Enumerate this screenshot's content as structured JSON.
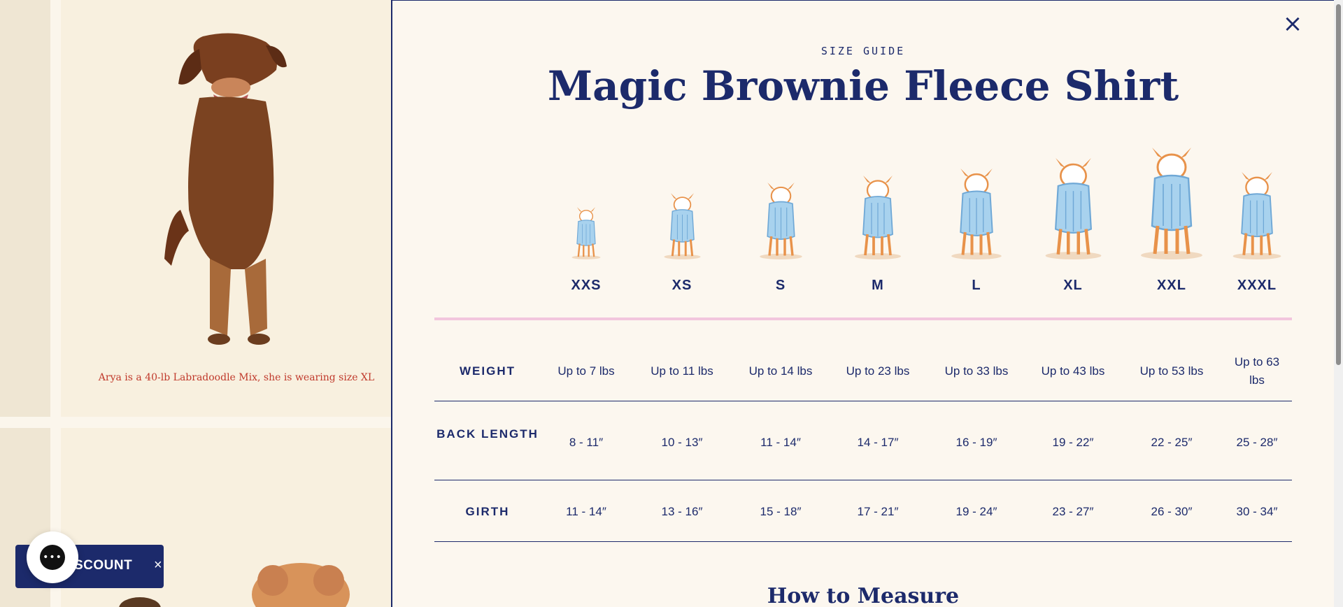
{
  "background": {
    "caption": "Arya is a 40-lb Labradoodle Mix, she is wearing size XL",
    "discount_label": "SCOUNT",
    "discount_close": "×",
    "chat_icon": "chat-bubble-icon"
  },
  "modal": {
    "close_label": "×",
    "eyebrow": "SIZE GUIDE",
    "title": "Magic Brownie Fleece Shirt",
    "sizes": [
      "XXS",
      "XS",
      "S",
      "M",
      "L",
      "XL",
      "XXL",
      "XXXL"
    ],
    "rows": [
      {
        "label": "WEIGHT",
        "values": [
          "Up to 7 lbs",
          "Up to 11 lbs",
          "Up to 14 lbs",
          "Up to 23 lbs",
          "Up to 33 lbs",
          "Up to 43 lbs",
          "Up to 53 lbs",
          "Up to 63 lbs"
        ]
      },
      {
        "label": "BACK LENGTH",
        "values": [
          "8 - 11″",
          "10 - 13″",
          "11 - 14″",
          "14 - 17″",
          "16 - 19″",
          "19 - 22″",
          "22 - 25″",
          "25 - 28″"
        ]
      },
      {
        "label": "GIRTH",
        "values": [
          "11 - 14″",
          "13 - 16″",
          "15 - 18″",
          "17 - 21″",
          "19 - 24″",
          "23 - 27″",
          "26 - 30″",
          "30 - 34″"
        ]
      }
    ],
    "how_to_measure": "How to Measure"
  },
  "colors": {
    "navy": "#1c2a6b",
    "pink_rule": "#f2c6dd",
    "caption_red": "#c0392b",
    "dog_orange": "#e8924a",
    "sweater_blue": "#a8d2ee"
  }
}
